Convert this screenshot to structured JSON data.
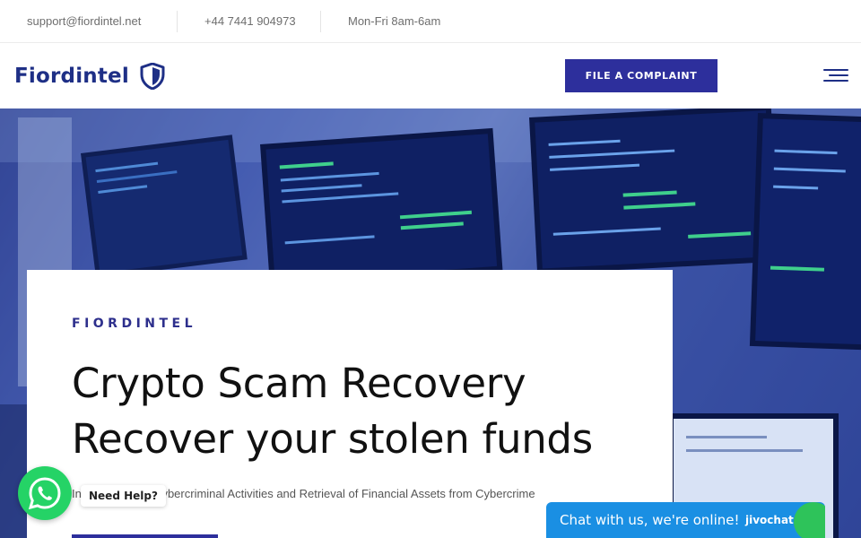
{
  "topbar": {
    "email": "support@fiordintel.net",
    "phone": "+44 7441 904973",
    "hours": "Mon-Fri 8am-6am"
  },
  "header": {
    "logo_text": "Fiordintel",
    "cta_label": "FILE A COMPLAINT"
  },
  "hero": {
    "eyebrow": "FIORDINTEL",
    "headline_line1": "Crypto Scam Recovery",
    "headline_line2": "Recover your stolen funds",
    "subtext": "Investigation of Cybercriminal Activities and Retrieval of Financial Assets from Cybercrime"
  },
  "widgets": {
    "whatsapp_tip": "Need Help?",
    "chat_text": "Chat with us, we're online!",
    "chat_brand": "jivochat"
  },
  "colors": {
    "brand": "#1e2f86",
    "accent": "#2d2f9c",
    "whatsapp": "#25d366",
    "chat": "#1a8fe3"
  },
  "icons": {
    "logo": "shield-icon",
    "menu": "hamburger-menu-icon",
    "whatsapp": "whatsapp-icon"
  }
}
